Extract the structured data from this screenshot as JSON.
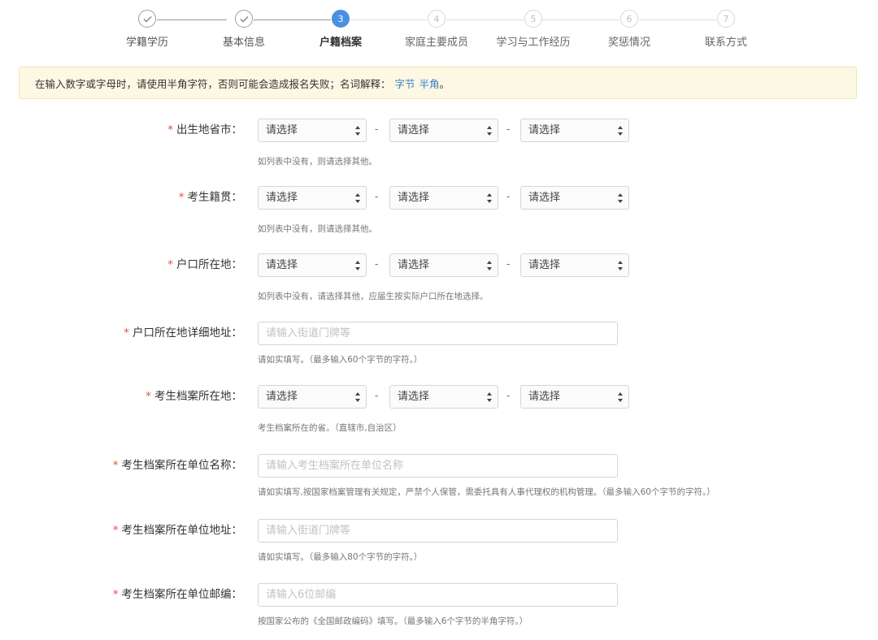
{
  "stepper": {
    "steps": [
      {
        "num": "1",
        "label": "学籍学历",
        "state": "done"
      },
      {
        "num": "2",
        "label": "基本信息",
        "state": "done"
      },
      {
        "num": "3",
        "label": "户籍档案",
        "state": "active"
      },
      {
        "num": "4",
        "label": "家庭主要成员",
        "state": "todo"
      },
      {
        "num": "5",
        "label": "学习与工作经历",
        "state": "todo"
      },
      {
        "num": "6",
        "label": "奖惩情况",
        "state": "todo"
      },
      {
        "num": "7",
        "label": "联系方式",
        "state": "todo"
      }
    ],
    "check_icon": "check-icon"
  },
  "notice": {
    "text": "在输入数字或字母时，请使用半角字符，否则可能会造成报名失败；名词解释：",
    "link1": "字节",
    "link2": "半角",
    "end": "。"
  },
  "form": {
    "required_mark": "*",
    "select_placeholder": "请选择",
    "separator": "-",
    "fields": {
      "birthplace": {
        "label": "出生地省市：",
        "hint": "如列表中没有，则请选择其他。"
      },
      "native_place": {
        "label": "考生籍贯：",
        "hint": "如列表中没有，则请选择其他。"
      },
      "hukou": {
        "label": "户口所在地：",
        "hint": "如列表中没有，请选择其他，应届生按实际户口所在地选择。"
      },
      "hukou_address": {
        "label": "户口所在地详细地址：",
        "placeholder": "请输入街道门牌等",
        "hint": "请如实填写。（最多输入60个字节的字符。）"
      },
      "archive_location": {
        "label": "考生档案所在地：",
        "hint": "考生档案所在的省。（直辖市,自治区）"
      },
      "archive_unit_name": {
        "label": "考生档案所在单位名称：",
        "placeholder": "请输入考生档案所在单位名称",
        "hint": "请如实填写,按国家档案管理有关规定，严禁个人保管，需委托具有人事代理权的机构管理。（最多输入60个字节的字符。）"
      },
      "archive_unit_address": {
        "label": "考生档案所在单位地址：",
        "placeholder": "请输入街道门牌等",
        "hint": "请如实填写。（最多输入80个字节的字符。）"
      },
      "archive_unit_zip": {
        "label": "考生档案所在单位邮编：",
        "placeholder": "请输入6位邮编",
        "hint": "按国家公布的《全国邮政编码》填写。（最多输入6个字节的半角字符。）"
      }
    }
  },
  "colors": {
    "accent": "#4a90e2",
    "required": "#e0543f",
    "notice_bg": "#fcf8e3",
    "link": "#3a7fc8"
  }
}
